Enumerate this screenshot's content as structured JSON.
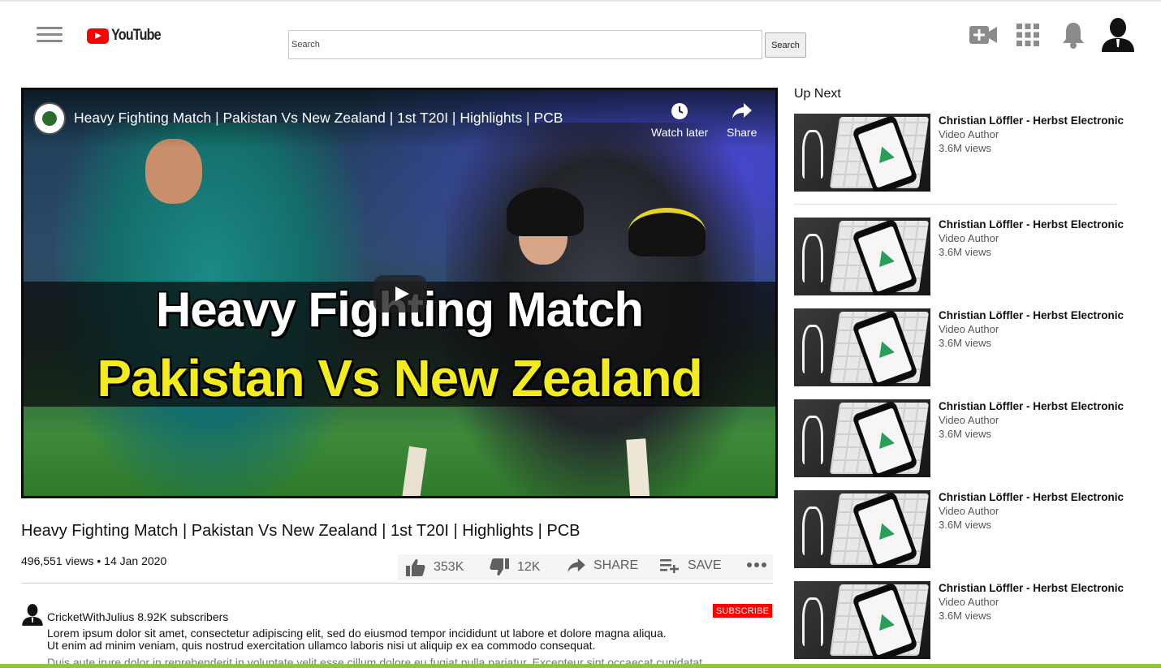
{
  "header": {
    "logo_text": "YouTube",
    "search_placeholder": "Search",
    "search_button": "Search"
  },
  "player": {
    "overlay_title": "Heavy Fighting Match | Pakistan Vs New Zealand | 1st T20I | Highlights | PCB",
    "thumbnail_line1": "Heavy Fighting Match",
    "thumbnail_line2": "Pakistan Vs New Zealand",
    "watch_later": "Watch later",
    "share": "Share"
  },
  "video": {
    "title": "Heavy Fighting Match | Pakistan Vs New Zealand | 1st T20I | Highlights | PCB",
    "meta": "496,551 views • 14 Jan 2020",
    "likes": "353K",
    "dislikes": "12K",
    "share_label": "SHARE",
    "save_label": "SAVE"
  },
  "owner": {
    "line": "CricketWithJulius 8.92K subscribers",
    "subscribe_label": "SUBSCRIBE",
    "desc_line1": "Lorem ipsum dolor sit amet, consectetur adipiscing elit, sed do eiusmod tempor incididunt ut labore et dolore magna aliqua.",
    "desc_line2": "Ut enim ad minim veniam, quis nostrud exercitation ullamco laboris nisi ut aliquip ex ea commodo consequat.",
    "desc_line3": "Duis aute irure dolor in reprehenderit in voluptate velit esse cillum dolore eu fugiat nulla pariatur. Excepteur sint occaecat cupidatat"
  },
  "sidebar": {
    "heading": "Up Next",
    "items": [
      {
        "title": "Christian Löffler - Herbst Electronic",
        "author": "Video Author",
        "views": "3.6M views"
      },
      {
        "title": "Christian Löffler - Herbst Electronic",
        "author": "Video Author",
        "views": "3.6M views"
      },
      {
        "title": "Christian Löffler - Herbst Electronic",
        "author": "Video Author",
        "views": "3.6M views"
      },
      {
        "title": "Christian Löffler - Herbst Electronic",
        "author": "Video Author",
        "views": "3.6M views"
      },
      {
        "title": "Christian Löffler - Herbst Electronic",
        "author": "Video Author",
        "views": "3.6M views"
      },
      {
        "title": "Christian Löffler - Herbst Electronic",
        "author": "Video Author",
        "views": "3.6M views"
      }
    ]
  },
  "colors": {
    "brand_red": "#ff0000",
    "accent_green": "#8dc63f",
    "icon_gray": "#8b8b8b"
  },
  "icons": [
    "menu-icon",
    "youtube-logo-icon",
    "create-video-icon",
    "apps-grid-icon",
    "notifications-bell-icon",
    "account-avatar-icon",
    "clock-icon",
    "share-arrow-icon",
    "play-icon",
    "thumbs-up-icon",
    "thumbs-down-icon",
    "playlist-add-icon",
    "more-icon"
  ]
}
